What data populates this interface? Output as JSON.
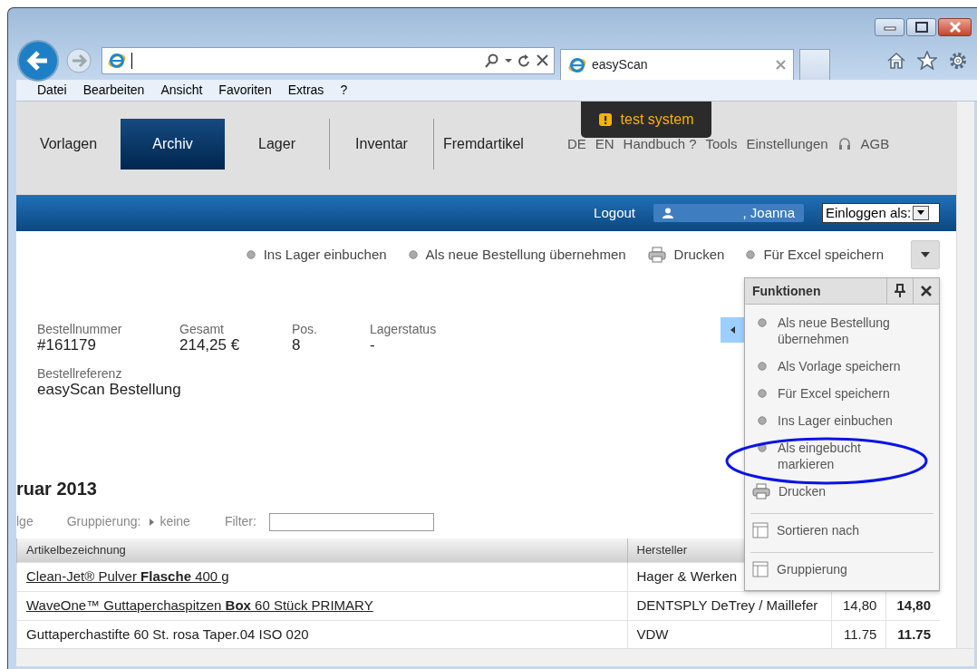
{
  "browser": {
    "tab_title": "easyScan",
    "menu": [
      {
        "label": "Datei"
      },
      {
        "label": "Bearbeiten"
      },
      {
        "label": "Ansicht"
      },
      {
        "label": "Favoriten"
      },
      {
        "label": "Extras"
      },
      {
        "label": "?"
      }
    ]
  },
  "nav": {
    "tabs": [
      {
        "label": "Vorlagen",
        "selected": false
      },
      {
        "label": "Archiv",
        "selected": true
      },
      {
        "label": "Lager",
        "selected": false
      },
      {
        "label": "Inventar",
        "selected": false
      },
      {
        "label": "Fremdartikel",
        "selected": false
      }
    ],
    "links": [
      "DE",
      "EN",
      "Handbuch ?",
      "Tools",
      "Einstellungen"
    ],
    "links_after_icon": [
      "AGB"
    ]
  },
  "toast": {
    "text": "test system"
  },
  "user_bar": {
    "logout": "Logout",
    "user": ", Joanna",
    "login_as": "Einloggen als:"
  },
  "actions": [
    {
      "label": "Ins Lager einbuchen",
      "kind": "dot"
    },
    {
      "label": "Als neue Bestellung übernehmen",
      "kind": "dot"
    },
    {
      "label": "Drucken",
      "kind": "printer"
    },
    {
      "label": "Für Excel speichern",
      "kind": "dot"
    }
  ],
  "order": {
    "fields": [
      {
        "label": "Bestellnummer",
        "value": "#161179"
      },
      {
        "label": "Gesamt",
        "value": "214,25 €"
      },
      {
        "label": "Pos.",
        "value": "8"
      },
      {
        "label": "Lagerstatus",
        "value": "-"
      }
    ],
    "reference": {
      "label": "Bestellreferenz",
      "value": "easyScan Bestellung"
    }
  },
  "section_title": "ruar 2013",
  "list_toolbar": {
    "sort_link": "lge",
    "grouping_label": "Gruppierung:",
    "grouping_value": "keine",
    "filter_label": "Filter:"
  },
  "table": {
    "columns": [
      "Artikelbezeichnung",
      "Hersteller"
    ],
    "rows": [
      {
        "name": "Clean-Jet® Pulver **Flasche** 400 g",
        "link": true,
        "manufacturer": "Hager & Werken"
      },
      {
        "name": "WaveOne™ Guttaperchaspitzen **Box** 60 Stück PRIMARY",
        "link": true,
        "manufacturer": "DENTSPLY DeTrey / Maillefer",
        "column_3": "14,80",
        "column_4": "14,80"
      },
      {
        "name": "Guttaperchastifte 60 St. rosa Taper.04 ISO 020",
        "link": false,
        "manufacturer": "VDW",
        "column_3": "11.75",
        "column_4": "11.75"
      }
    ]
  },
  "functions_panel": {
    "title": "Funktionen",
    "items": [
      {
        "label": "Als neue Bestellung übernehmen",
        "kind": "dot",
        "separator_before": false
      },
      {
        "label": "Als Vorlage speichern",
        "kind": "dot",
        "separator_before": false
      },
      {
        "label": "Für Excel speichern",
        "kind": "dot",
        "separator_before": false
      },
      {
        "label": "Ins Lager einbuchen",
        "kind": "dot",
        "separator_before": false
      },
      {
        "label": "Als eingebucht markieren",
        "kind": "dot",
        "separator_before": false
      },
      {
        "label": "Drucken",
        "kind": "printer",
        "separator_before": false
      },
      {
        "label": "Sortieren nach",
        "kind": "columns",
        "separator_before": true
      },
      {
        "label": "Gruppierung",
        "kind": "columns",
        "separator_before": true
      }
    ]
  }
}
